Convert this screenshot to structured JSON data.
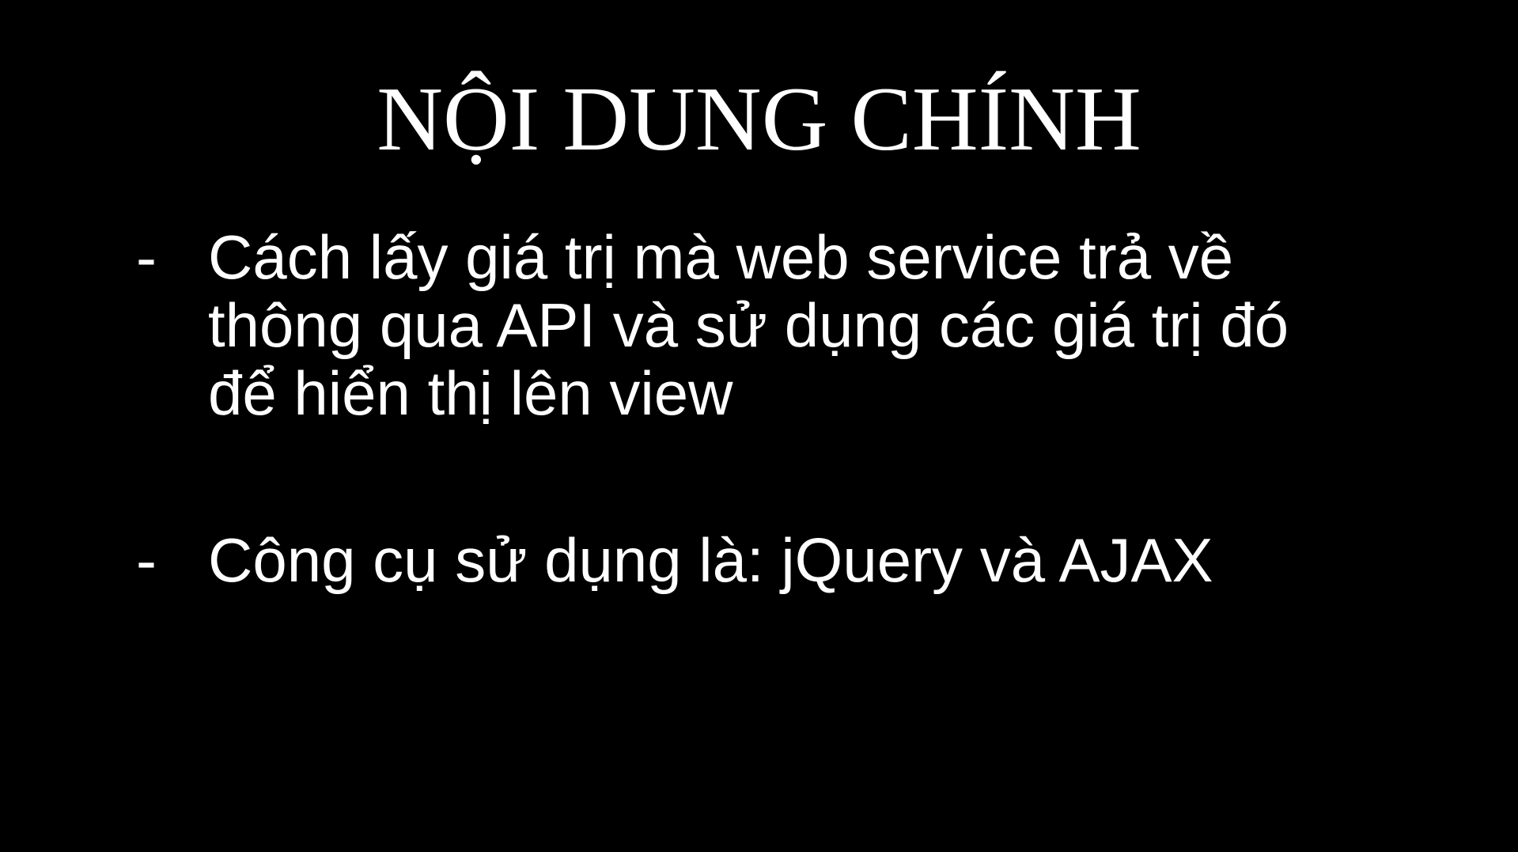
{
  "slide": {
    "title": "NỘI DUNG CHÍNH",
    "bullets": [
      {
        "marker": "-",
        "lines": [
          "Cách lấy giá trị mà web service trả về",
          "thông qua API và sử dụng các giá trị đó",
          "để hiển thị lên view"
        ]
      },
      {
        "marker": "-",
        "lines": [
          "Công cụ sử dụng là: jQuery và AJAX"
        ]
      }
    ],
    "colors": {
      "background": "#000000",
      "text": "#ffffff"
    }
  }
}
